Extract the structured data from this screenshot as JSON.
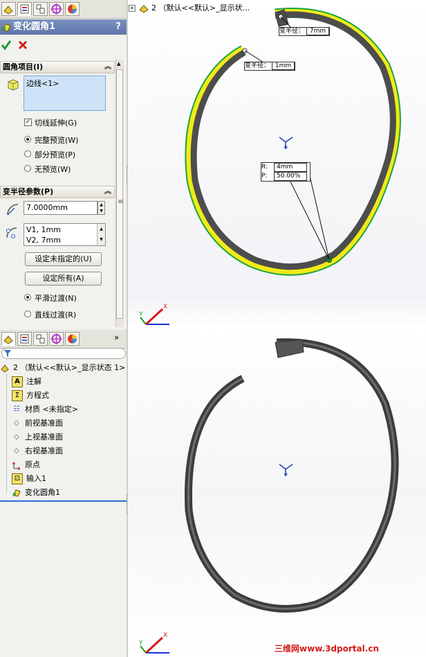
{
  "top_panel": {
    "feature_title": "变化圆角1",
    "help_icon": "?",
    "sections": {
      "fillet_items": {
        "title": "圆角项目(I)",
        "edge_list": [
          "边线<1>"
        ],
        "tangent_propagation": "切线延伸(G)",
        "full_preview": "完整预览(W)",
        "partial_preview": "部分预览(P)",
        "no_preview": "无预览(W)"
      },
      "variable_radius": {
        "title": "变半径参数(P)",
        "radius_value": "7.0000mm",
        "vertex_list": [
          "V1, 1mm",
          "V2, 7mm"
        ],
        "set_unassigned": "设定未指定的(U)",
        "set_all": "设定所有(A)",
        "smooth_transition": "平滑过渡(N)",
        "straight_transition": "直线过渡(R)"
      }
    }
  },
  "tree": {
    "root": "2 （默认<<默认>_显示状态 1>",
    "items": [
      "注解",
      "方程式",
      "材质 <未指定>",
      "前视基准面",
      "上视基准面",
      "右视基准面",
      "原点",
      "输入1",
      "变化圆角1"
    ],
    "collapse_label": "»"
  },
  "viewport": {
    "header_title": "2 （默认<<默认>_显示状...",
    "callout_top_right": {
      "label": "变半径：",
      "value": "7mm"
    },
    "callout_left": {
      "label": "变半径：",
      "value": "1mm"
    },
    "callout_mid": {
      "r_label": "R:",
      "r_value": "4mm",
      "p_label": "P:",
      "p_value": "50.00%"
    },
    "axes_labels": {
      "x": "X",
      "y": "Y"
    },
    "watermark": {
      "site": "三维网",
      "url": "www.3dportal.cn"
    }
  },
  "colors": {
    "title_bar": "#6880b4",
    "accent_yellow": "#f2ea18",
    "accent_green": "#19a33f",
    "ring_gray": "#4d4d4d",
    "watermark_red": "#d11a1a"
  },
  "icons": [
    "feature-manager-icon",
    "property-manager-icon",
    "configuration-manager-icon",
    "dimxpert-icon",
    "display-manager-icon",
    "ok-check-icon",
    "cancel-x-icon"
  ]
}
